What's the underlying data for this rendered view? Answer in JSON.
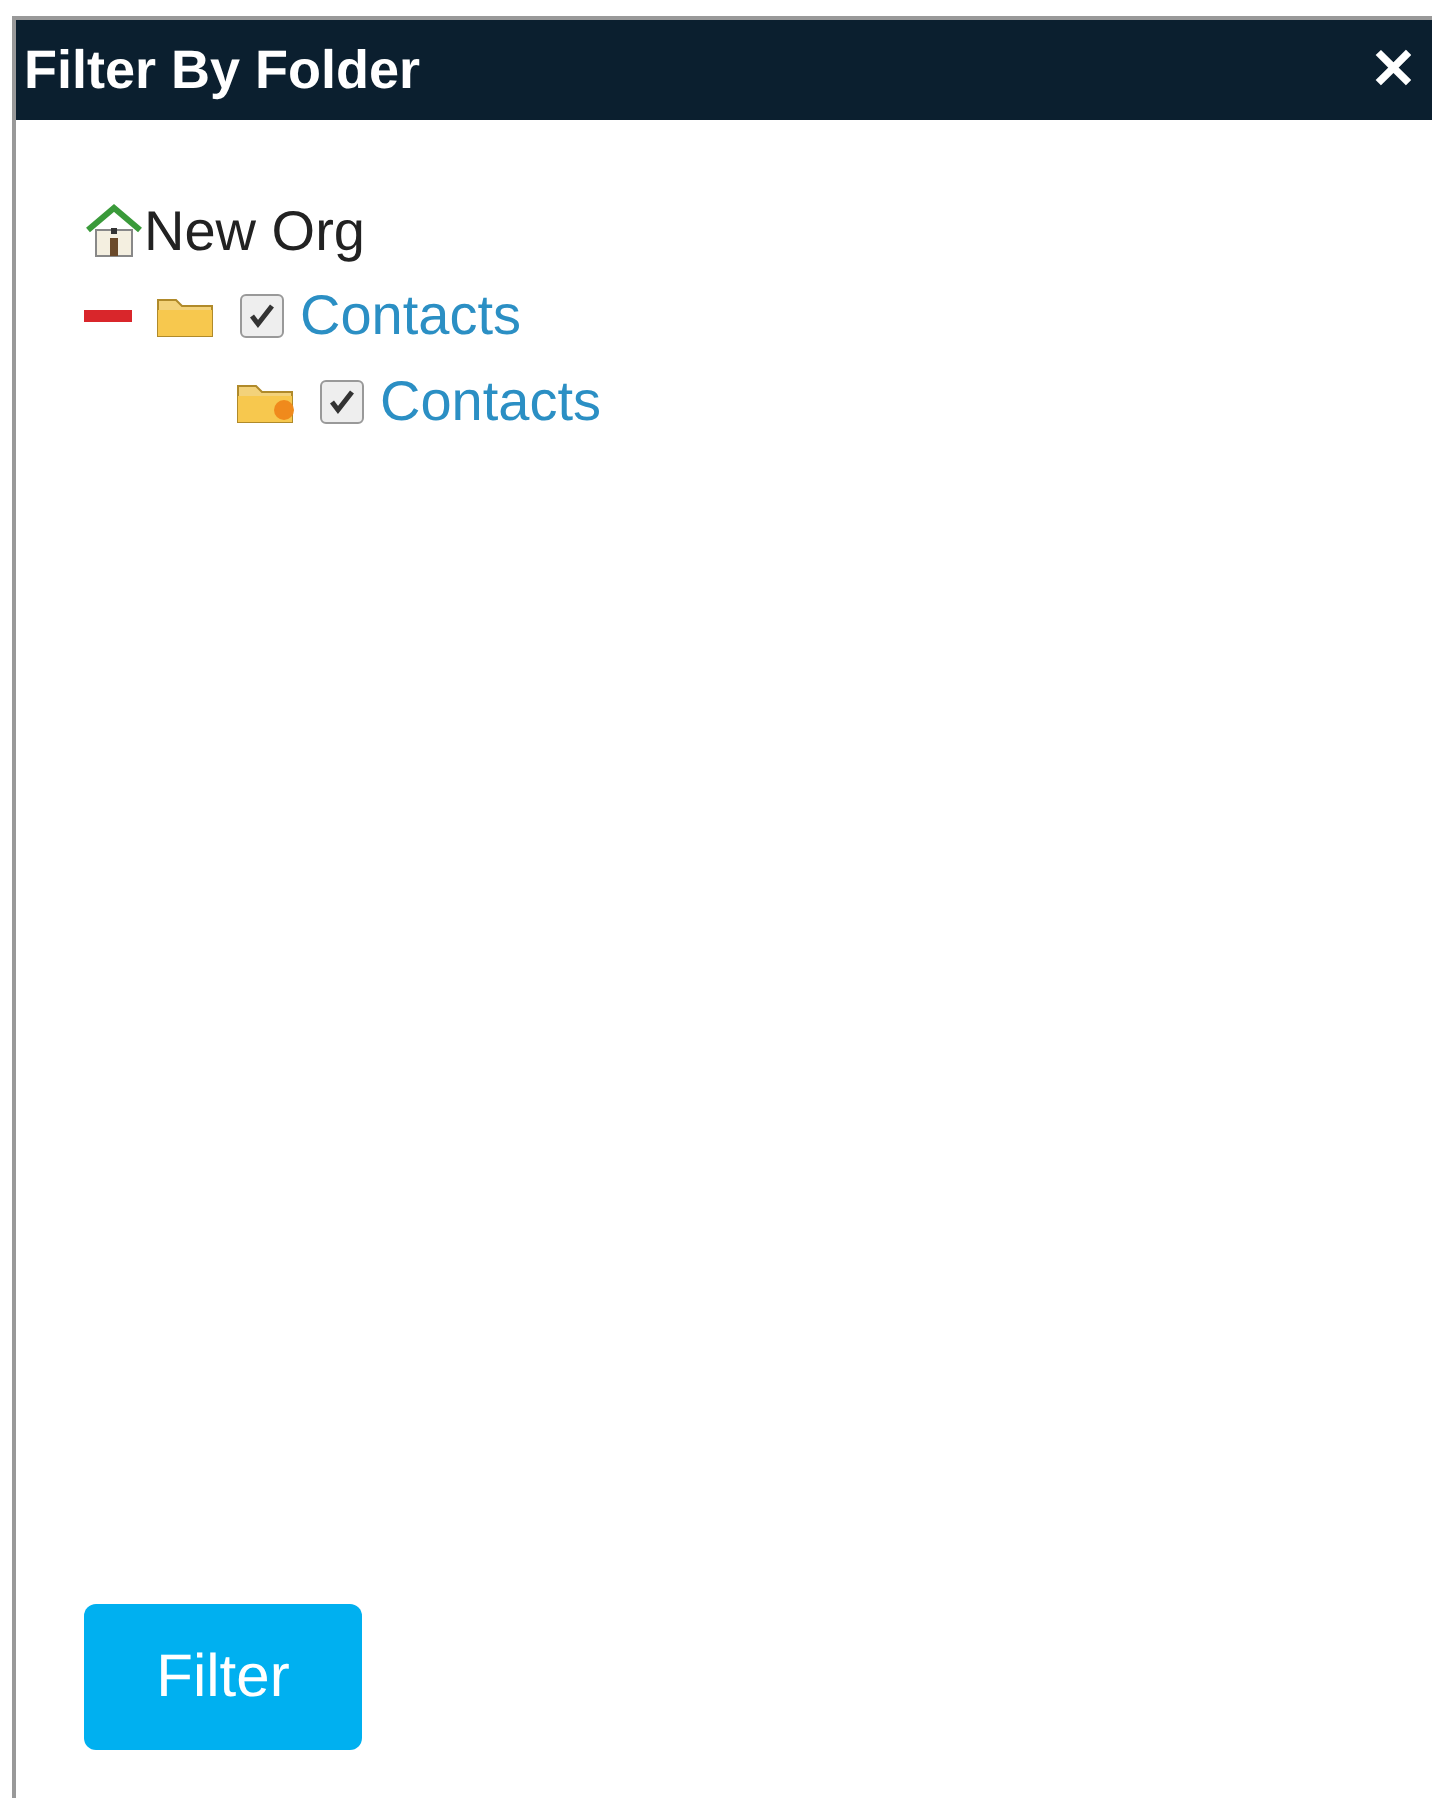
{
  "window": {
    "title": "Filter By Folder",
    "close": "✕"
  },
  "tree": {
    "label": "New Org",
    "children": [
      {
        "label": "Contacts",
        "checked": true,
        "expanded": true,
        "children": [
          {
            "label": "Contacts",
            "checked": true,
            "kind": "shared"
          }
        ]
      }
    ]
  },
  "button": "Filter"
}
